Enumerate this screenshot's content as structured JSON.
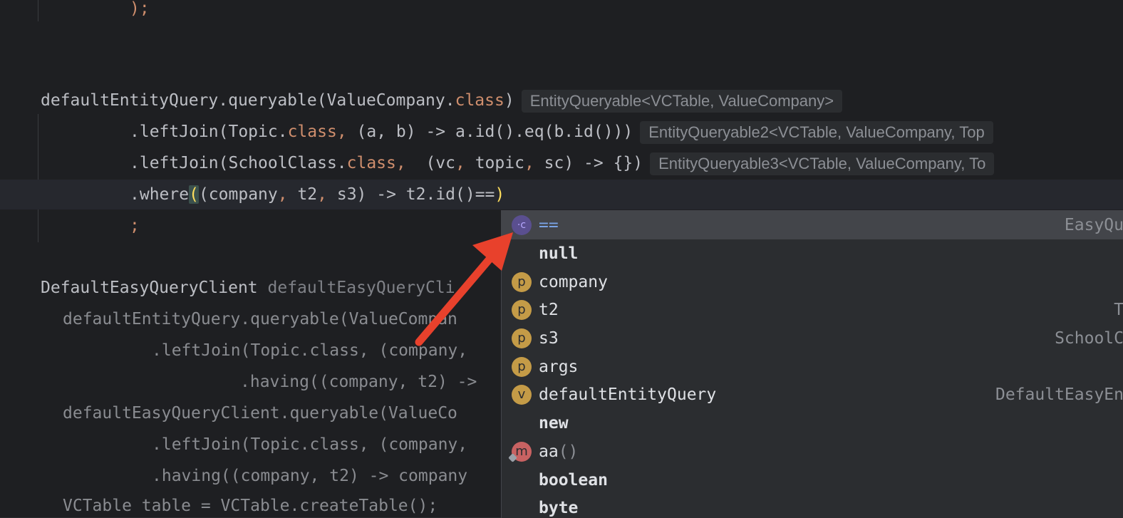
{
  "editor": {
    "lines": {
      "l0": ");",
      "l1_a": "defaultEntityQuery.queryable(ValueCompany.",
      "l1_b": "class",
      "l1_c": ")",
      "l1_hint": "EntityQueryable<VCTable, ValueCompany>",
      "l2_a": ".leftJoin(Topic.",
      "l2_b": "class",
      "l2_c": ", ",
      "l2_d": "(a, b) -> a.id().eq(b.id()))",
      "l2_hint": "EntityQueryable2<VCTable, ValueCompany, Top",
      "l3_a": ".leftJoin(SchoolClass.",
      "l3_b": "class",
      "l3_c": ",  ",
      "l3_d": "(vc",
      "l3_e": ", ",
      "l3_f": "topic",
      "l3_g": ", ",
      "l3_h": "sc) -> {})",
      "l3_hint": "EntityQueryable3<VCTable, ValueCompany, To",
      "l4_a": ".where",
      "l4_b": "(",
      "l4_c": "(company",
      "l4_d": ", ",
      "l4_e": "t2",
      "l4_f": ", ",
      "l4_g": "s3) -> t2.id()==",
      "l4_h": ")",
      "l5": ";",
      "l6_a": "DefaultEasyQueryClient ",
      "l6_b": "defaultEasyQueryCli",
      "l7": "defaultEntityQuery.queryable(ValueCompan",
      "l8": ".leftJoin(Topic.class, (company,",
      "l9": ".having((company, t2) ->",
      "l10": "defaultEasyQueryClient.queryable(ValueCo",
      "l11": ".leftJoin(Topic.class, (company,",
      "l12": ".having((company, t2) -> company",
      "l13": "VCTable table = VCTable.createTable();"
    }
  },
  "completion": {
    "items": [
      {
        "badge": "tmpl",
        "badge_text": "·c",
        "name": "==",
        "type": "EasyQu",
        "selected": true
      },
      {
        "badge": "",
        "badge_text": "",
        "name": "null",
        "type": ""
      },
      {
        "badge": "p",
        "badge_text": "p",
        "name": "company",
        "type": ""
      },
      {
        "badge": "p",
        "badge_text": "p",
        "name": "t2",
        "type": "T"
      },
      {
        "badge": "p",
        "badge_text": "p",
        "name": "s3",
        "type": "SchoolC"
      },
      {
        "badge": "p",
        "badge_text": "p",
        "name": "args",
        "type": ""
      },
      {
        "badge": "v",
        "badge_text": "v",
        "name": "defaultEntityQuery",
        "type": "DefaultEasyEn"
      },
      {
        "badge": "",
        "badge_text": "",
        "name": "new",
        "type": ""
      },
      {
        "badge": "m",
        "badge_text": "m",
        "name": "aa",
        "args": "()",
        "type": ""
      },
      {
        "badge": "",
        "badge_text": "",
        "name": "boolean",
        "type": ""
      },
      {
        "badge": "",
        "badge_text": "",
        "name": "byte",
        "type": ""
      }
    ]
  },
  "colors": {
    "background": "#1e1f22",
    "keyword": "#cf8e6d",
    "popup_bg": "#2b2d30",
    "arrow": "#e8412c"
  }
}
